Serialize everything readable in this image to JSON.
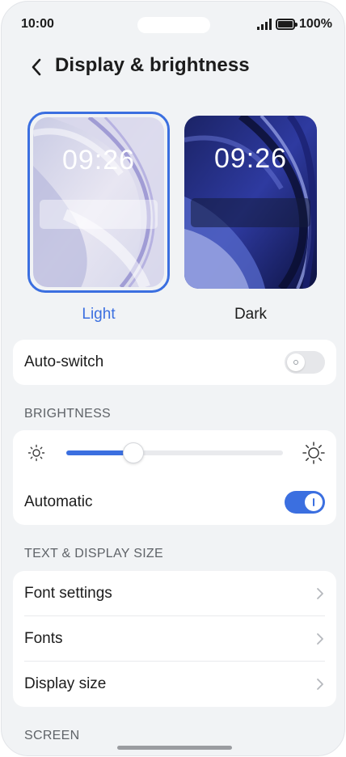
{
  "status_bar": {
    "time": "10:00",
    "battery": "100%"
  },
  "header": {
    "title": "Display & brightness"
  },
  "themes": {
    "light": {
      "preview_time": "09:26",
      "label": "Light",
      "selected": true
    },
    "dark": {
      "preview_time": "09:26",
      "label": "Dark",
      "selected": false
    }
  },
  "auto_switch": {
    "label": "Auto-switch",
    "on": false
  },
  "brightness": {
    "section": "BRIGHTNESS",
    "level_fraction": 0.31,
    "automatic_label": "Automatic",
    "automatic_on": true
  },
  "text_display": {
    "section": "TEXT & DISPLAY SIZE",
    "items": [
      {
        "label": "Font settings"
      },
      {
        "label": "Fonts"
      },
      {
        "label": "Display size"
      }
    ]
  },
  "screen": {
    "section": "SCREEN"
  },
  "colors": {
    "accent": "#3b6fe0",
    "background": "#f1f3f5",
    "card": "#ffffff"
  }
}
